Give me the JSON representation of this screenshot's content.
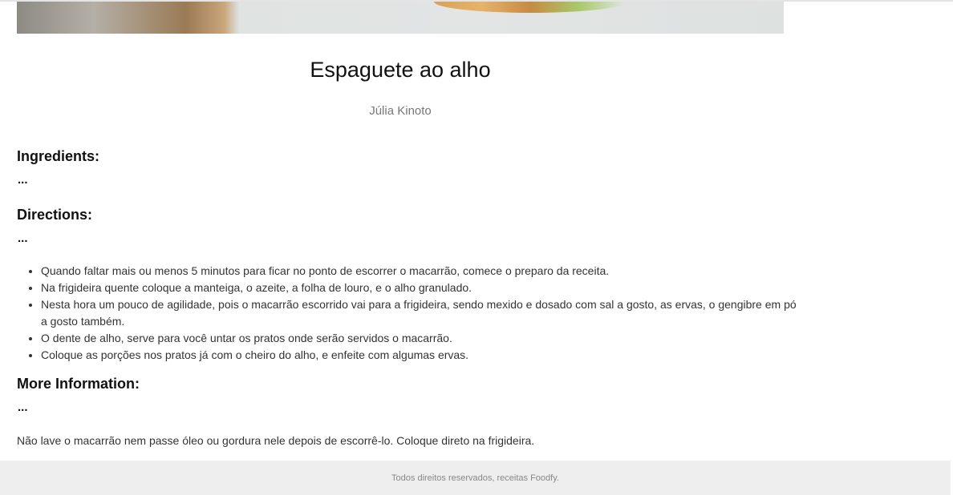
{
  "recipe": {
    "title": "Espaguete ao alho",
    "author": "Júlia Kinoto"
  },
  "sections": {
    "ingredients": {
      "heading": "Ingredients:",
      "toggle": "..."
    },
    "directions": {
      "heading": "Directions:",
      "toggle": "...",
      "steps": [
        "Quando faltar mais ou menos 5 minutos para ficar no ponto de escorrer o macarrão, comece o preparo da receita.",
        "Na frigideira quente coloque a manteiga, o azeite, a folha de louro, e o alho granulado.",
        "Nesta hora um pouco de agilidade, pois o macarrão escorrido vai para a frigideira, sendo mexido e dosado com sal a gosto, as ervas, o gengibre em pó a gosto também.",
        "O dente de alho, serve para você untar os pratos onde serão servidos o macarrão.",
        "Coloque as porções nos pratos já com o cheiro do alho, e enfeite com algumas ervas."
      ]
    },
    "info": {
      "heading": "More Information:",
      "toggle": "...",
      "text": "Não lave o macarrão nem passe óleo ou gordura nele depois de escorrê-lo. Coloque direto na frigideira."
    }
  },
  "footer": {
    "text": "Todos direitos reservados, receitas Foodfy."
  }
}
